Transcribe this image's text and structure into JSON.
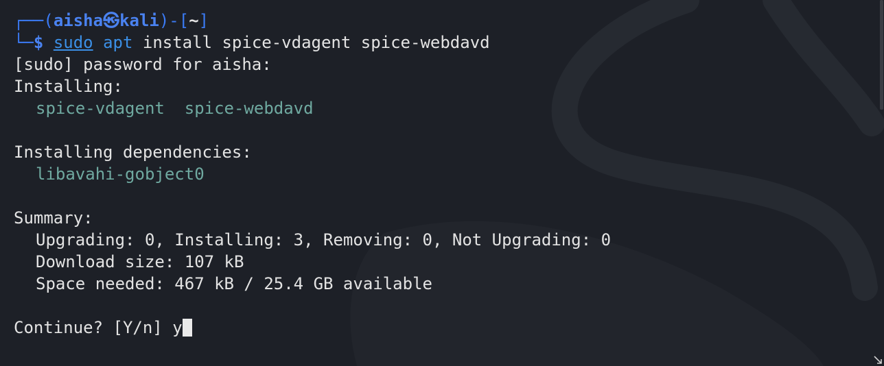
{
  "prompt": {
    "corner_top": "┌──",
    "corner_bottom": "└─",
    "paren_open": "(",
    "user": "aisha",
    "separator": "㉿",
    "host": "kali",
    "paren_close": ")-[",
    "path": "~",
    "bracket_close": "]",
    "dollar": "$"
  },
  "command": {
    "sudo": "sudo",
    "apt": "apt",
    "rest": "install spice-vdagent spice-webdavd"
  },
  "output": {
    "password_prompt": "[sudo] password for aisha:",
    "installing_header": "Installing:",
    "installing_packages": "spice-vdagent  spice-webdavd",
    "deps_header": "Installing dependencies:",
    "deps_packages": "libavahi-gobject0",
    "summary_header": "Summary:",
    "summary_line1": "Upgrading: 0, Installing: 3, Removing: 0, Not Upgrading: 0",
    "summary_line2": "Download size: 107 kB",
    "summary_line3": "Space needed: 467 kB / 25.4 GB available",
    "continue_prompt": "Continue? [Y/n] ",
    "user_input": "y"
  },
  "colors": {
    "background": "#1d2027",
    "prompt_blue": "#4a82f0",
    "package_teal": "#6fa9a0",
    "text": "#e3e3e3"
  },
  "icons": {
    "background": "kali-dragon-watermark",
    "grip": "resize-grip-icon"
  }
}
